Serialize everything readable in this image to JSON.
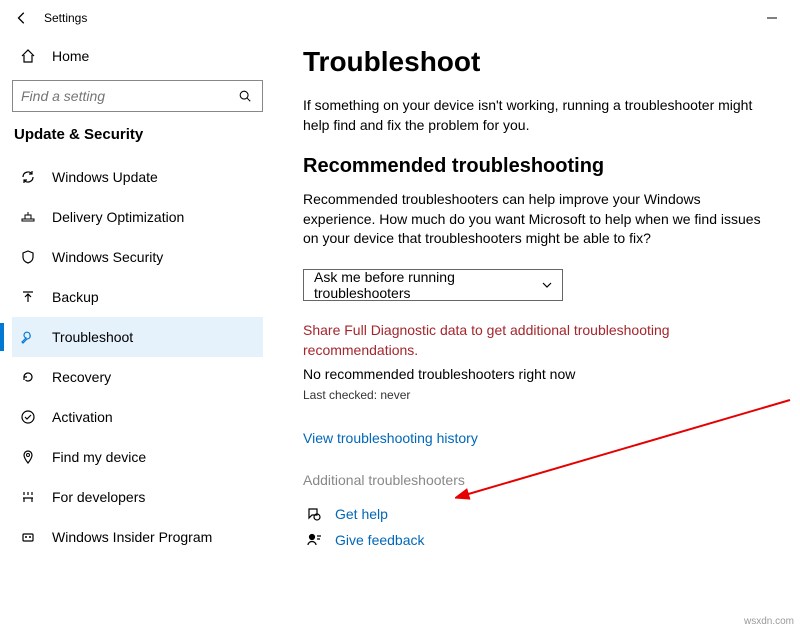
{
  "titlebar": {
    "title": "Settings"
  },
  "sidebar": {
    "home": "Home",
    "searchPlaceholder": "Find a setting",
    "groupTitle": "Update & Security",
    "items": [
      {
        "label": "Windows Update"
      },
      {
        "label": "Delivery Optimization"
      },
      {
        "label": "Windows Security"
      },
      {
        "label": "Backup"
      },
      {
        "label": "Troubleshoot"
      },
      {
        "label": "Recovery"
      },
      {
        "label": "Activation"
      },
      {
        "label": "Find my device"
      },
      {
        "label": "For developers"
      },
      {
        "label": "Windows Insider Program"
      }
    ]
  },
  "main": {
    "heading": "Troubleshoot",
    "intro": "If something on your device isn't working, running a troubleshooter might help find and fix the problem for you.",
    "recHeading": "Recommended troubleshooting",
    "recDesc": "Recommended troubleshooters can help improve your Windows experience. How much do you want Microsoft to help when we find issues on your device that troubleshooters might be able to fix?",
    "dropdownValue": "Ask me before running troubleshooters",
    "warn": "Share Full Diagnostic data to get additional troubleshooting recommendations.",
    "noRec": "No recommended troubleshooters right now",
    "lastChecked": "Last checked: never",
    "historyLink": "View troubleshooting history",
    "additional": "Additional troubleshooters",
    "getHelp": "Get help",
    "giveFeedback": "Give feedback"
  },
  "watermark": "wsxdn.com"
}
